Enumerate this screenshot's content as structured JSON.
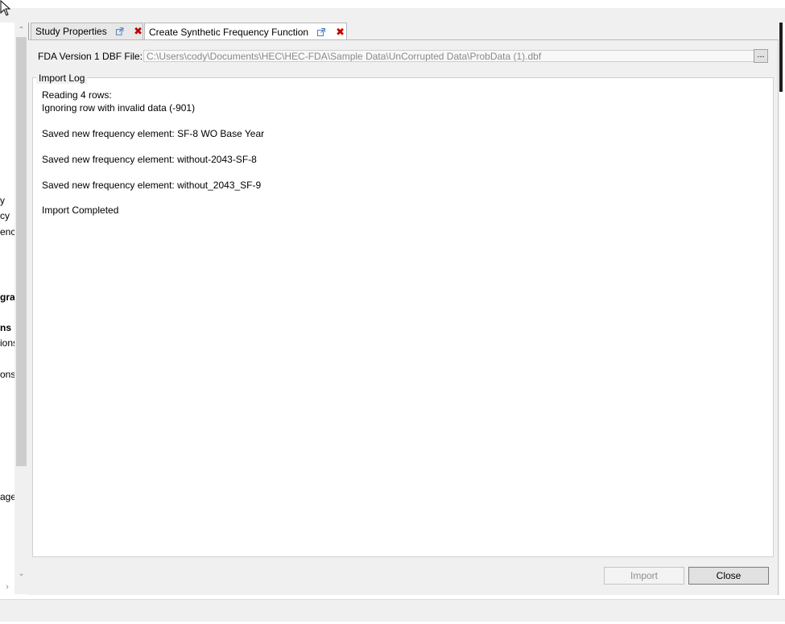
{
  "left_panel": {
    "items": [
      "y",
      "cy",
      "ency",
      "grar",
      "ns",
      "ions",
      "ons",
      "age"
    ]
  },
  "tabs": [
    {
      "label": "Study Properties",
      "active": false
    },
    {
      "label": "Create Synthetic Frequency Function",
      "active": true
    }
  ],
  "import_form": {
    "file_label": "FDA Version 1 DBF File:",
    "file_path": "C:\\Users\\cody\\Documents\\HEC\\HEC-FDA\\Sample Data\\UnCorrupted Data\\ProbData (1).dbf",
    "browse_label": "...",
    "log_title": "Import Log",
    "log_lines": [
      "Reading 4 rows:",
      "Ignoring row with invalid data (-901)",
      "Saved new frequency element: SF-8 WO Base Year",
      "Saved new frequency element: without-2043-SF-8",
      "Saved new frequency element: without_2043_SF-9",
      "Import Completed"
    ]
  },
  "buttons": {
    "import_label": "Import",
    "close_label": "Close"
  },
  "colors": {
    "close_tab_x": "#c00000",
    "disabled_text": "#8f8f8f"
  }
}
